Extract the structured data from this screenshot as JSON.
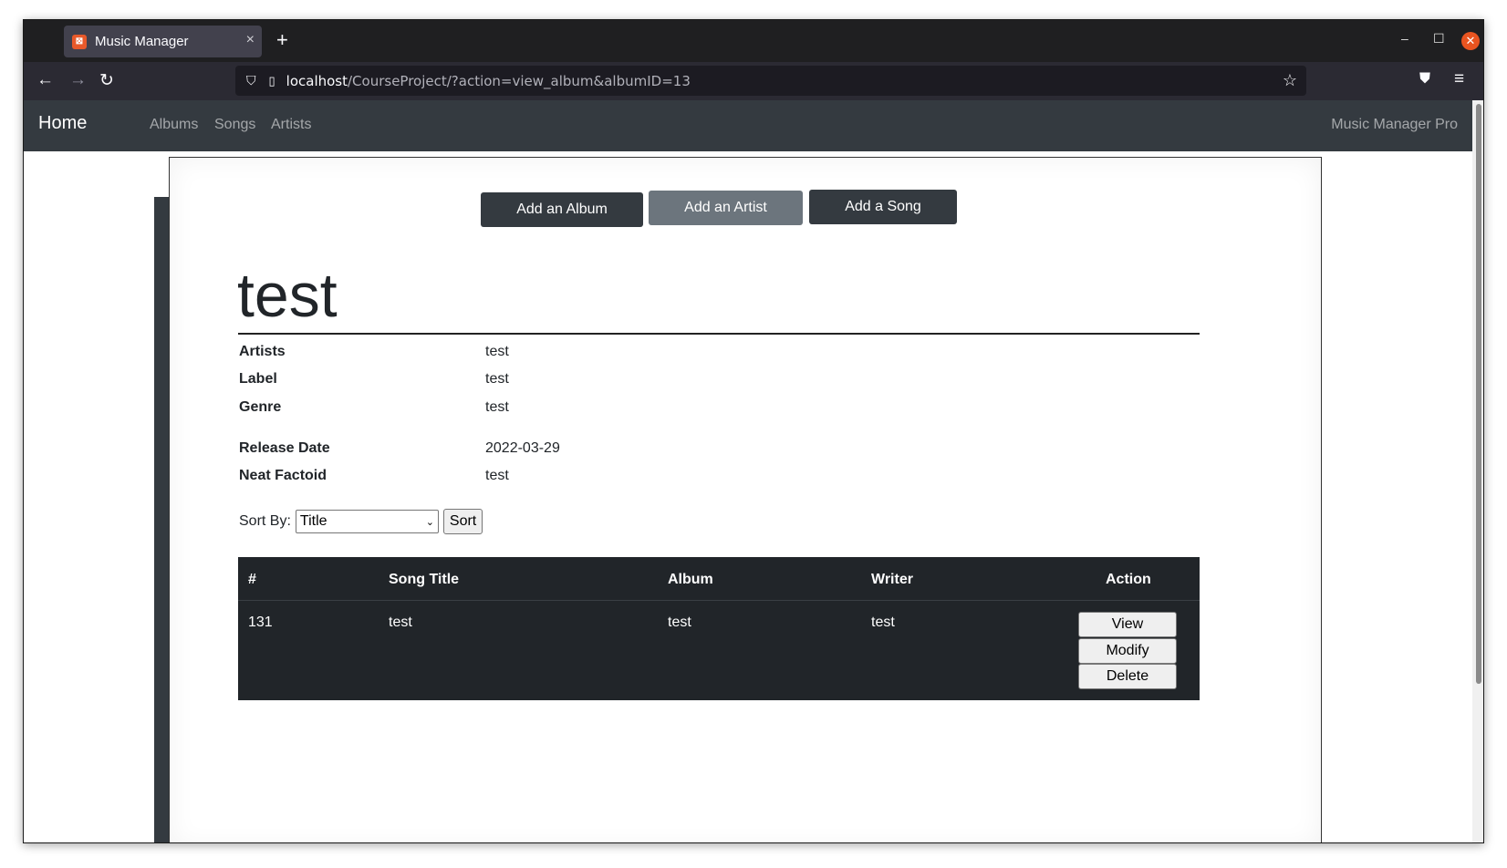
{
  "browser": {
    "tab_title": "Music Manager",
    "tab_close": "×",
    "new_tab": "+",
    "url_host": "localhost",
    "url_path": "/CourseProject/?action=view_album&albumID=13"
  },
  "site_nav": {
    "brand": "Home",
    "links": [
      "Albums",
      "Songs",
      "Artists"
    ],
    "right": "Music Manager Pro"
  },
  "actions": {
    "add_album": "Add an Album",
    "add_artist": "Add an Artist",
    "add_song": "Add a Song"
  },
  "album": {
    "title": "test",
    "details": [
      {
        "label": "Artists",
        "value": "test"
      },
      {
        "label": "Label",
        "value": "test"
      },
      {
        "label": "Genre",
        "value": "test"
      },
      {
        "label": "Release Date",
        "value": "2022-03-29"
      },
      {
        "label": "Neat Factoid",
        "value": "test"
      }
    ]
  },
  "sort": {
    "label": "Sort By:",
    "selected": "Title",
    "button": "Sort"
  },
  "table": {
    "headers": [
      "#",
      "Song Title",
      "Album",
      "Writer",
      "Action"
    ],
    "rows": [
      {
        "id": "131",
        "title": "test",
        "album": "test",
        "writer": "test",
        "actions": [
          "View",
          "Modify",
          "Delete"
        ]
      }
    ]
  }
}
